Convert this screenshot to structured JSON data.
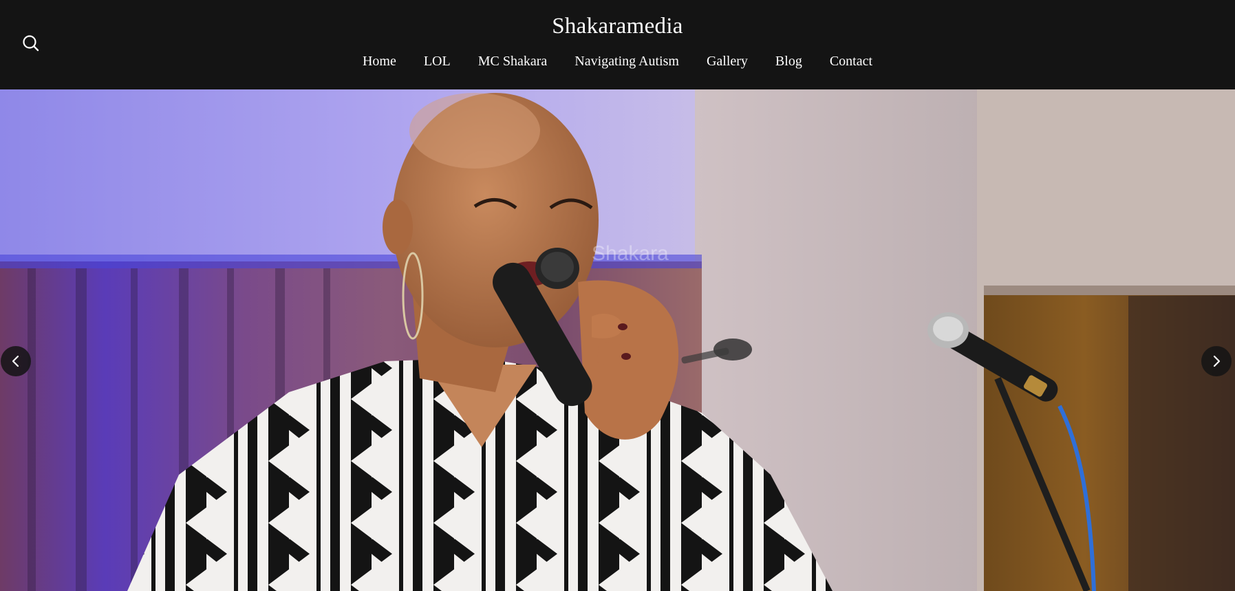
{
  "header": {
    "site_title": "Shakaramedia",
    "search_icon": "search-icon"
  },
  "nav": {
    "items": [
      {
        "label": "Home"
      },
      {
        "label": "LOL"
      },
      {
        "label": "MC Shakara"
      },
      {
        "label": "Navigating Autism"
      },
      {
        "label": "Gallery"
      },
      {
        "label": "Blog"
      },
      {
        "label": "Contact"
      }
    ]
  },
  "hero": {
    "watermark": "Shakara",
    "prev_icon": "chevron-left-icon",
    "next_icon": "chevron-right-icon"
  },
  "colors": {
    "header_bg": "#141414",
    "text": "#ffffff",
    "arrow_bg": "#141414"
  }
}
